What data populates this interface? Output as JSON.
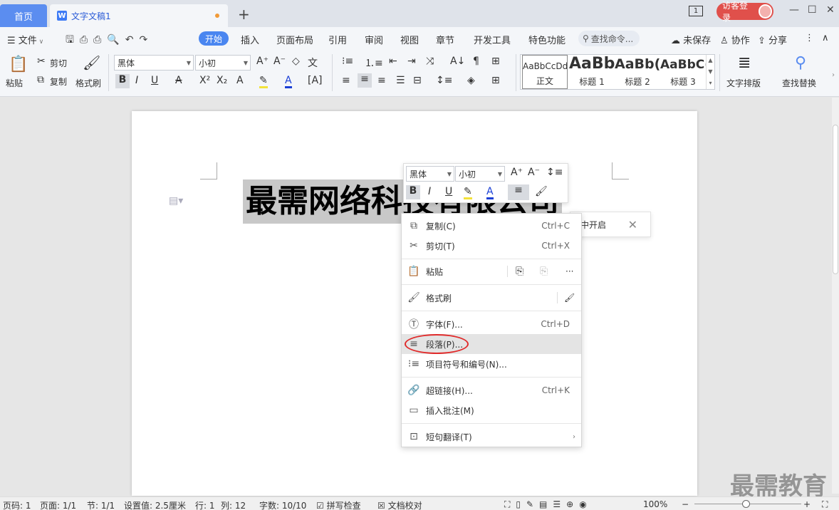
{
  "titlebar": {
    "home_tab": "首页",
    "doc_tab": "文字文稿1",
    "doc_icon": "W",
    "new_tab": "+",
    "page_indicator": "1",
    "login_label": "访客登录",
    "minimize": "—",
    "maximize": "☐",
    "close": "✕"
  },
  "menubar": {
    "file": "文件",
    "items": [
      "开始",
      "插入",
      "页面布局",
      "引用",
      "审阅",
      "视图",
      "章节",
      "开发工具",
      "特色功能"
    ],
    "search": "查找命令...",
    "unsaved": "未保存",
    "collab": "协作",
    "share": "分享"
  },
  "ribbon": {
    "paste": "粘贴",
    "cut": "剪切",
    "copy": "复制",
    "format_painter": "格式刷",
    "font_name": "黑体",
    "font_size": "小初",
    "styles": [
      {
        "preview": "AaBbCcDd",
        "name": "正文"
      },
      {
        "preview": "AaBb",
        "name": "标题 1"
      },
      {
        "preview": "AaBb(",
        "name": "标题 2"
      },
      {
        "preview": "AaBbC(",
        "name": "标题 3"
      }
    ],
    "text_layout": "文字排版",
    "find_replace": "查找替换"
  },
  "document": {
    "heading": "最需网络科技有限公司"
  },
  "mini_toolbar": {
    "font_name": "黑体",
    "font_size": "小初"
  },
  "notification": {
    "text": "中开启"
  },
  "context_menu": {
    "items": [
      {
        "label": "复制(C)",
        "shortcut": "Ctrl+C",
        "icon": "copy-icon"
      },
      {
        "label": "剪切(T)",
        "shortcut": "Ctrl+X",
        "icon": "scissors-icon"
      },
      {
        "label": "粘贴",
        "shortcut": "",
        "icon": "paste-icon"
      },
      {
        "label": "格式刷",
        "shortcut": "",
        "icon": "format-painter-icon"
      },
      {
        "label": "字体(F)...",
        "shortcut": "Ctrl+D",
        "icon": "font-icon"
      },
      {
        "label": "段落(P)...",
        "shortcut": "",
        "icon": "paragraph-icon"
      },
      {
        "label": "项目符号和编号(N)...",
        "shortcut": "",
        "icon": "list-icon"
      },
      {
        "label": "超链接(H)...",
        "shortcut": "Ctrl+K",
        "icon": "link-icon"
      },
      {
        "label": "插入批注(M)",
        "shortcut": "",
        "icon": "comment-icon"
      },
      {
        "label": "短句翻译(T)",
        "shortcut": "",
        "icon": "translate-icon"
      }
    ],
    "paste_more": "···"
  },
  "statusbar": {
    "page_num": "页码: 1",
    "pages": "页面: 1/1",
    "section": "节: 1/1",
    "setting": "设置值: 2.5厘米",
    "row": "行: 1",
    "col": "列: 12",
    "words": "字数: 10/10",
    "spell": "拼写检查",
    "proof": "文档校对",
    "zoom": "100%"
  },
  "watermark": "最需教育"
}
